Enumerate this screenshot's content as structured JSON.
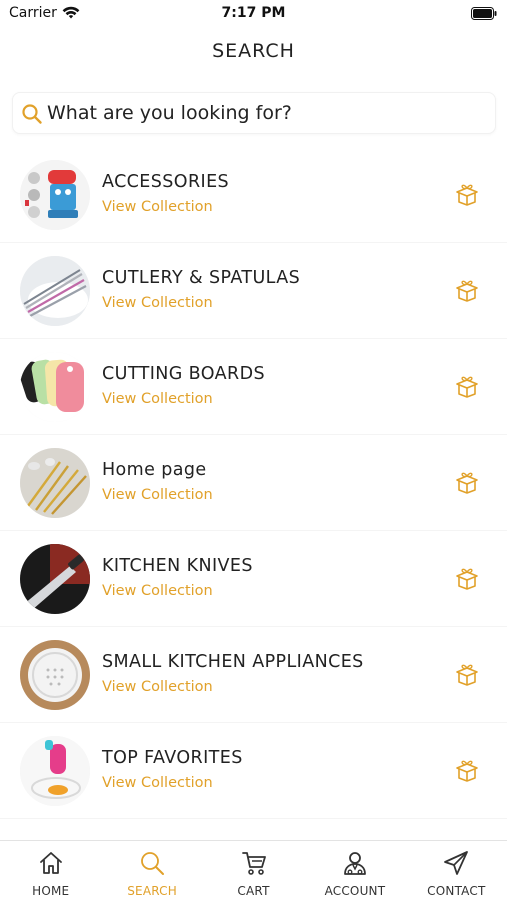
{
  "status_bar": {
    "carrier": "Carrier",
    "time": "7:17 PM"
  },
  "header": {
    "title": "SEARCH"
  },
  "search": {
    "placeholder": "What are you looking for?"
  },
  "colors": {
    "accent": "#E1A12A",
    "text": "#222222",
    "divider": "#F4F4F4"
  },
  "collections": [
    {
      "title": "ACCESSORIES",
      "link": "View Collection",
      "icon": "gift-icon"
    },
    {
      "title": "CUTLERY & SPATULAS",
      "link": "View Collection",
      "icon": "gift-icon"
    },
    {
      "title": "CUTTING BOARDS",
      "link": "View Collection",
      "icon": "gift-icon"
    },
    {
      "title": "Home page",
      "link": "View Collection",
      "icon": "gift-icon"
    },
    {
      "title": "KITCHEN KNIVES",
      "link": "View Collection",
      "icon": "gift-icon"
    },
    {
      "title": "SMALL KITCHEN APPLIANCES",
      "link": "View Collection",
      "icon": "gift-icon"
    },
    {
      "title": "TOP FAVORITES",
      "link": "View Collection",
      "icon": "gift-icon"
    }
  ],
  "tab_bar": {
    "items": [
      {
        "label": "HOME",
        "icon": "home-icon",
        "active": false
      },
      {
        "label": "SEARCH",
        "icon": "search-icon",
        "active": true
      },
      {
        "label": "CART",
        "icon": "cart-icon",
        "active": false
      },
      {
        "label": "ACCOUNT",
        "icon": "account-icon",
        "active": false
      },
      {
        "label": "CONTACT",
        "icon": "send-icon",
        "active": false
      }
    ]
  }
}
